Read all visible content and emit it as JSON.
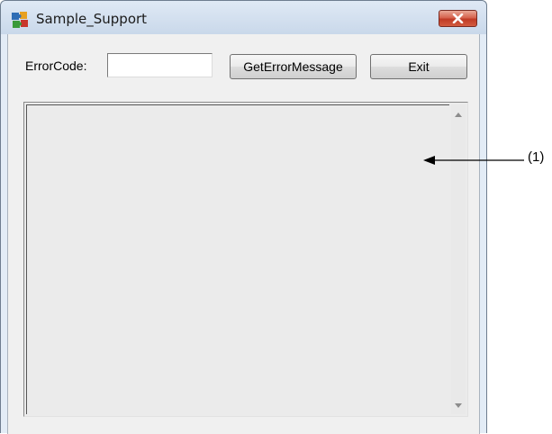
{
  "window": {
    "title": "Sample_Support",
    "icon": "app-puzzle-icon",
    "close_icon": "close-icon"
  },
  "form": {
    "error_code_label": "ErrorCode:",
    "error_code_value": "",
    "get_error_message_label": "GetErrorMessage",
    "exit_label": "Exit"
  },
  "message_area": {
    "text": "",
    "scroll_up_icon": "scroll-up-arrow-icon",
    "scroll_down_icon": "scroll-down-arrow-icon"
  },
  "annotation": {
    "callout_label": "(1)"
  },
  "colors": {
    "close_button": "#c03a25",
    "titlebar": "#c9d8ea",
    "client_bg": "#f0f0f0"
  }
}
